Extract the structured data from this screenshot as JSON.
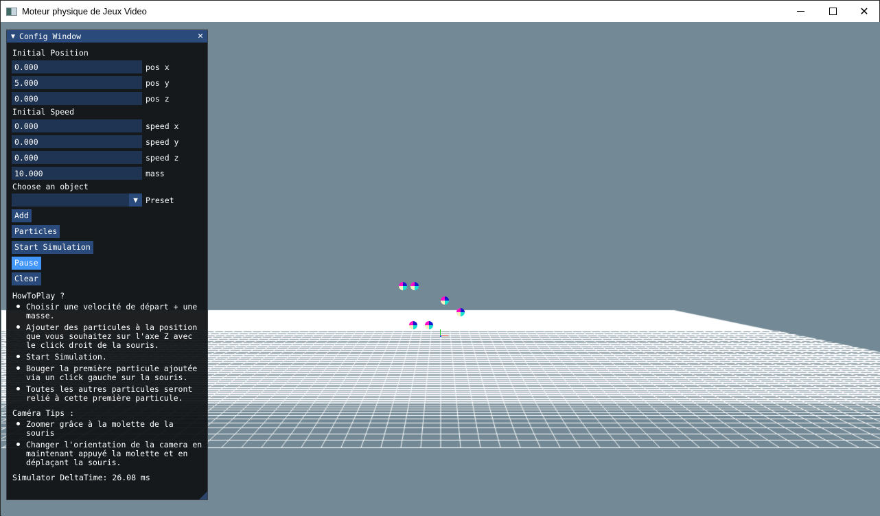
{
  "window": {
    "title": "Moteur physique de Jeux Video",
    "controls": {
      "minimize": "minimize",
      "maximize": "maximize",
      "close": "close"
    }
  },
  "config": {
    "title": "Config Window",
    "collapse_icon": "▼",
    "close_icon": "✕",
    "initial_position_label": "Initial Position",
    "position": [
      {
        "value": "0.000",
        "label": "pos x"
      },
      {
        "value": "5.000",
        "label": "pos y"
      },
      {
        "value": "0.000",
        "label": "pos z"
      }
    ],
    "initial_speed_label": "Initial Speed",
    "speed": [
      {
        "value": "0.000",
        "label": "speed x"
      },
      {
        "value": "0.000",
        "label": "speed y"
      },
      {
        "value": "0.000",
        "label": "speed z"
      }
    ],
    "mass": {
      "value": "10.000",
      "label": "mass"
    },
    "choose_object_label": "Choose an object",
    "preset": {
      "value": "",
      "label": "Preset",
      "arrow": "▼"
    },
    "buttons": {
      "add": "Add",
      "particles": "Particles",
      "start": "Start Simulation",
      "pause": "Pause",
      "clear": "Clear"
    },
    "howto_title": "HowToPlay ?",
    "howto": [
      "Choisir une velocité de départ + une masse.",
      "Ajouter des particules à la position que vous souhaitez sur l'axe Z avec le click droit de la souris.",
      "Start Simulation.",
      "Bouger la première particule ajoutée via un click gauche sur la souris.",
      "Toutes les autres particules seront relié à cette première particule."
    ],
    "camera_title": "Caméra Tips :",
    "camera": [
      "Zoomer grâce à la molette de la souris",
      "Changer l'orientation de la camera en maintenant appuyé la molette et en déplaçant la souris."
    ],
    "delta_time": "Simulator DeltaTime: 26.08 ms"
  },
  "scene": {
    "background_color": "#738a96",
    "floor_color": "#ffffff",
    "particle_count": 6,
    "axis_colors": {
      "x": "#e02020",
      "y": "#20d020",
      "z": "#2040ff"
    }
  }
}
